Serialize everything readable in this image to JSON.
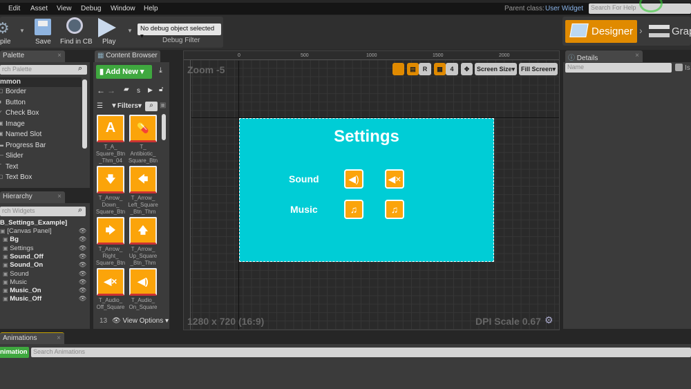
{
  "menu": [
    "Edit",
    "Asset",
    "View",
    "Debug",
    "Window",
    "Help"
  ],
  "parent_class": {
    "label": "Parent class:",
    "value": "User Widget"
  },
  "help_search": {
    "placeholder": "Search For Help"
  },
  "toolbar": {
    "compile": "pile",
    "save": "Save",
    "find": "Find in CB",
    "play": "Play",
    "debug_select": "No debug object selected",
    "debug_filter": "Debug Filter"
  },
  "modes": {
    "designer": "Designer",
    "graph": "Grap"
  },
  "palette": {
    "tab": "Palette",
    "search_placeholder": "rch Palette",
    "category": "mmon",
    "items": [
      "Border",
      "Button",
      "Check Box",
      "Image",
      "Named Slot",
      "Progress Bar",
      "Slider",
      "Text",
      "Text Box"
    ]
  },
  "hierarchy": {
    "tab": "Hierarchy",
    "search_placeholder": "rch Widgets",
    "root": "B_Settings_Example]",
    "items": [
      {
        "label": "[Canvas Panel]",
        "bold": false
      },
      {
        "label": "Bg",
        "bold": true
      },
      {
        "label": "Settings",
        "bold": false
      },
      {
        "label": "Sound_Off",
        "bold": true
      },
      {
        "label": "Sound_On",
        "bold": true
      },
      {
        "label": "Sound",
        "bold": false
      },
      {
        "label": "Music",
        "bold": false
      },
      {
        "label": "Music_On",
        "bold": true
      },
      {
        "label": "Music_Off",
        "bold": true
      }
    ]
  },
  "content_browser": {
    "tab": "Content Browser",
    "add_new": "Add New",
    "path": "s",
    "filters": "Filters",
    "count": "13",
    "view_options": "View Options",
    "assets": [
      {
        "glyph": "A",
        "name": "T_A_\nSquare_Btn\n_Thm_04"
      },
      {
        "glyph": "💊",
        "name": "T_\nAntibiotic_\nSquare_Btn"
      },
      {
        "glyph": "🡇",
        "name": "T_Arrow_\nDown_\nSquare_Btn"
      },
      {
        "glyph": "🡄",
        "name": "T_Arrow_\nLeft_Square\n_Btn_Thm"
      },
      {
        "glyph": "🡆",
        "name": "T_Arrow_\nRight_\nSquare_Btn"
      },
      {
        "glyph": "🡅",
        "name": "T_Arrow_\nUp_Square\n_Btn_Thm"
      },
      {
        "glyph": "◀×",
        "name": "T_Audio_\nOff_Square"
      },
      {
        "glyph": "◀)",
        "name": "T_Audio_\nOn_Square"
      }
    ]
  },
  "viewport": {
    "zoom": "Zoom -5",
    "ruler_x": [
      "0",
      "500",
      "1000",
      "1500",
      "2000"
    ],
    "grid_snap": "4",
    "reset": "R",
    "screen_size": "Screen Size",
    "fill_screen": "Fill Screen",
    "resolution": "1280 x 720 (16:9)",
    "dpi": "DPI Scale 0.67"
  },
  "widget": {
    "title": "Settings",
    "sound": "Sound",
    "music": "Music",
    "bg_color": "#00cdd6",
    "accent": "#fba40a"
  },
  "details": {
    "tab": "Details",
    "name_placeholder": "Name",
    "is_label": "Is"
  },
  "animations": {
    "tab": "Animations",
    "add_button": "nimation",
    "search_placeholder": "Search Animations"
  }
}
